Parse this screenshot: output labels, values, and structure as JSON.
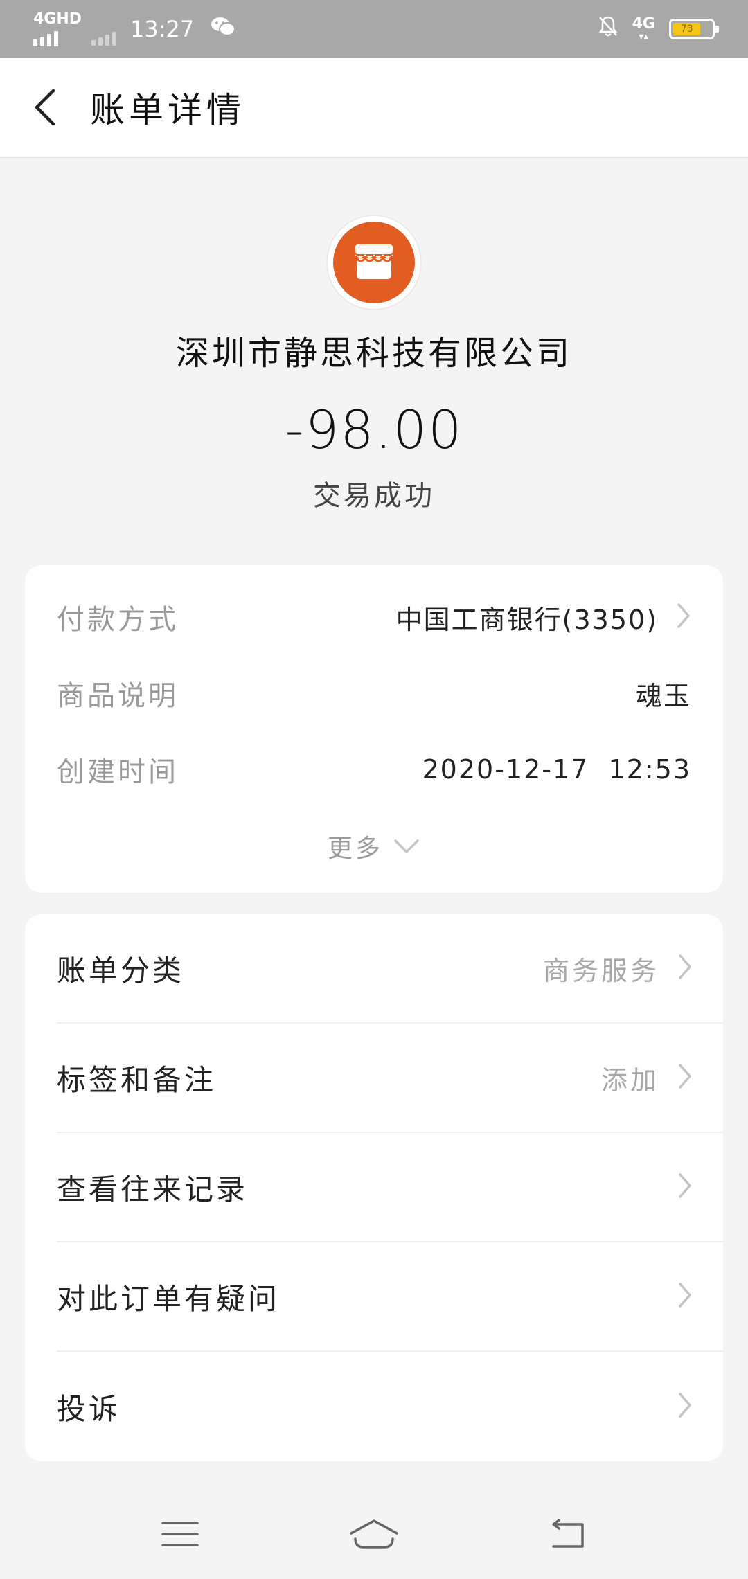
{
  "status_bar": {
    "network": "4GHD",
    "time": "13:27",
    "network2": "4G",
    "battery": "73",
    "battery_level_percent": 73
  },
  "nav": {
    "title": "账单详情"
  },
  "merchant": {
    "name": "深圳市静思科技有限公司",
    "amount": "-98.00",
    "status": "交易成功",
    "avatar_color": "#e25d21"
  },
  "details": {
    "payment_method": {
      "label": "付款方式",
      "value": "中国工商银行(3350)"
    },
    "product": {
      "label": "商品说明",
      "value": "魂玉"
    },
    "created_time": {
      "label": "创建时间",
      "value": "2020-12-17  12:53"
    },
    "more_label": "更多"
  },
  "actions": {
    "category": {
      "label": "账单分类",
      "value": "商务服务"
    },
    "tags": {
      "label": "标签和备注",
      "value": "添加"
    },
    "history": {
      "label": "查看往来记录"
    },
    "question": {
      "label": "对此订单有疑问"
    },
    "complaint": {
      "label": "投诉"
    }
  },
  "icons": {
    "back": "back-arrow-icon",
    "shop": "shop-icon",
    "chevron": "chevron-right-icon",
    "more": "chevron-down-icon",
    "menu": "menu-icon",
    "home": "home-icon",
    "return": "return-icon"
  }
}
